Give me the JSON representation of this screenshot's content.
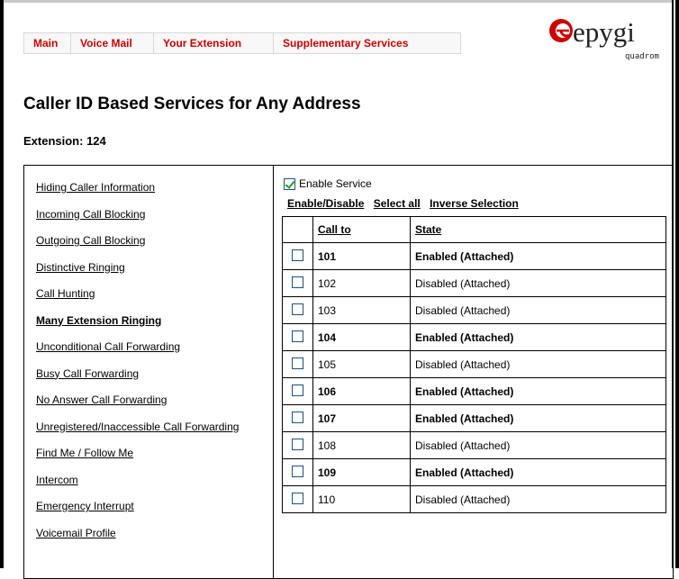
{
  "nav": {
    "tabs": [
      "Main",
      "Voice Mail",
      "Your Extension",
      "Supplementary Services"
    ]
  },
  "logo": {
    "brand": "epygi",
    "sub": "quadrom",
    "accent": "#cc0000"
  },
  "page": {
    "title": "Caller ID Based Services for Any Address",
    "extension": "Extension: 124"
  },
  "sidebar": {
    "items": [
      "Hiding Caller Information",
      "Incoming Call Blocking",
      "Outgoing Call Blocking",
      "Distinctive Ringing",
      "Call Hunting",
      "Many Extension Ringing",
      "Unconditional Call Forwarding",
      "Busy Call Forwarding",
      "No Answer Call Forwarding",
      "Unregistered/Inaccessible Call Forwarding",
      "Find Me / Follow Me",
      "Intercom",
      "Emergency Interrupt",
      "Voicemail Profile"
    ],
    "active_index": 5
  },
  "service": {
    "enable_label": "Enable Service",
    "enabled": true,
    "actions": [
      "Enable/Disable",
      "Select all",
      "Inverse Selection"
    ]
  },
  "table": {
    "headers": [
      "Call to",
      "State"
    ],
    "rows": [
      {
        "call_to": "101",
        "state": "Enabled (Attached)",
        "enabled": true
      },
      {
        "call_to": "102",
        "state": "Disabled (Attached)",
        "enabled": false
      },
      {
        "call_to": "103",
        "state": "Disabled (Attached)",
        "enabled": false
      },
      {
        "call_to": "104",
        "state": "Enabled (Attached)",
        "enabled": true
      },
      {
        "call_to": "105",
        "state": "Disabled (Attached)",
        "enabled": false
      },
      {
        "call_to": "106",
        "state": "Enabled (Attached)",
        "enabled": true
      },
      {
        "call_to": "107",
        "state": "Enabled (Attached)",
        "enabled": true
      },
      {
        "call_to": "108",
        "state": "Disabled (Attached)",
        "enabled": false
      },
      {
        "call_to": "109",
        "state": "Enabled (Attached)",
        "enabled": true
      },
      {
        "call_to": "110",
        "state": "Disabled (Attached)",
        "enabled": false
      }
    ]
  }
}
